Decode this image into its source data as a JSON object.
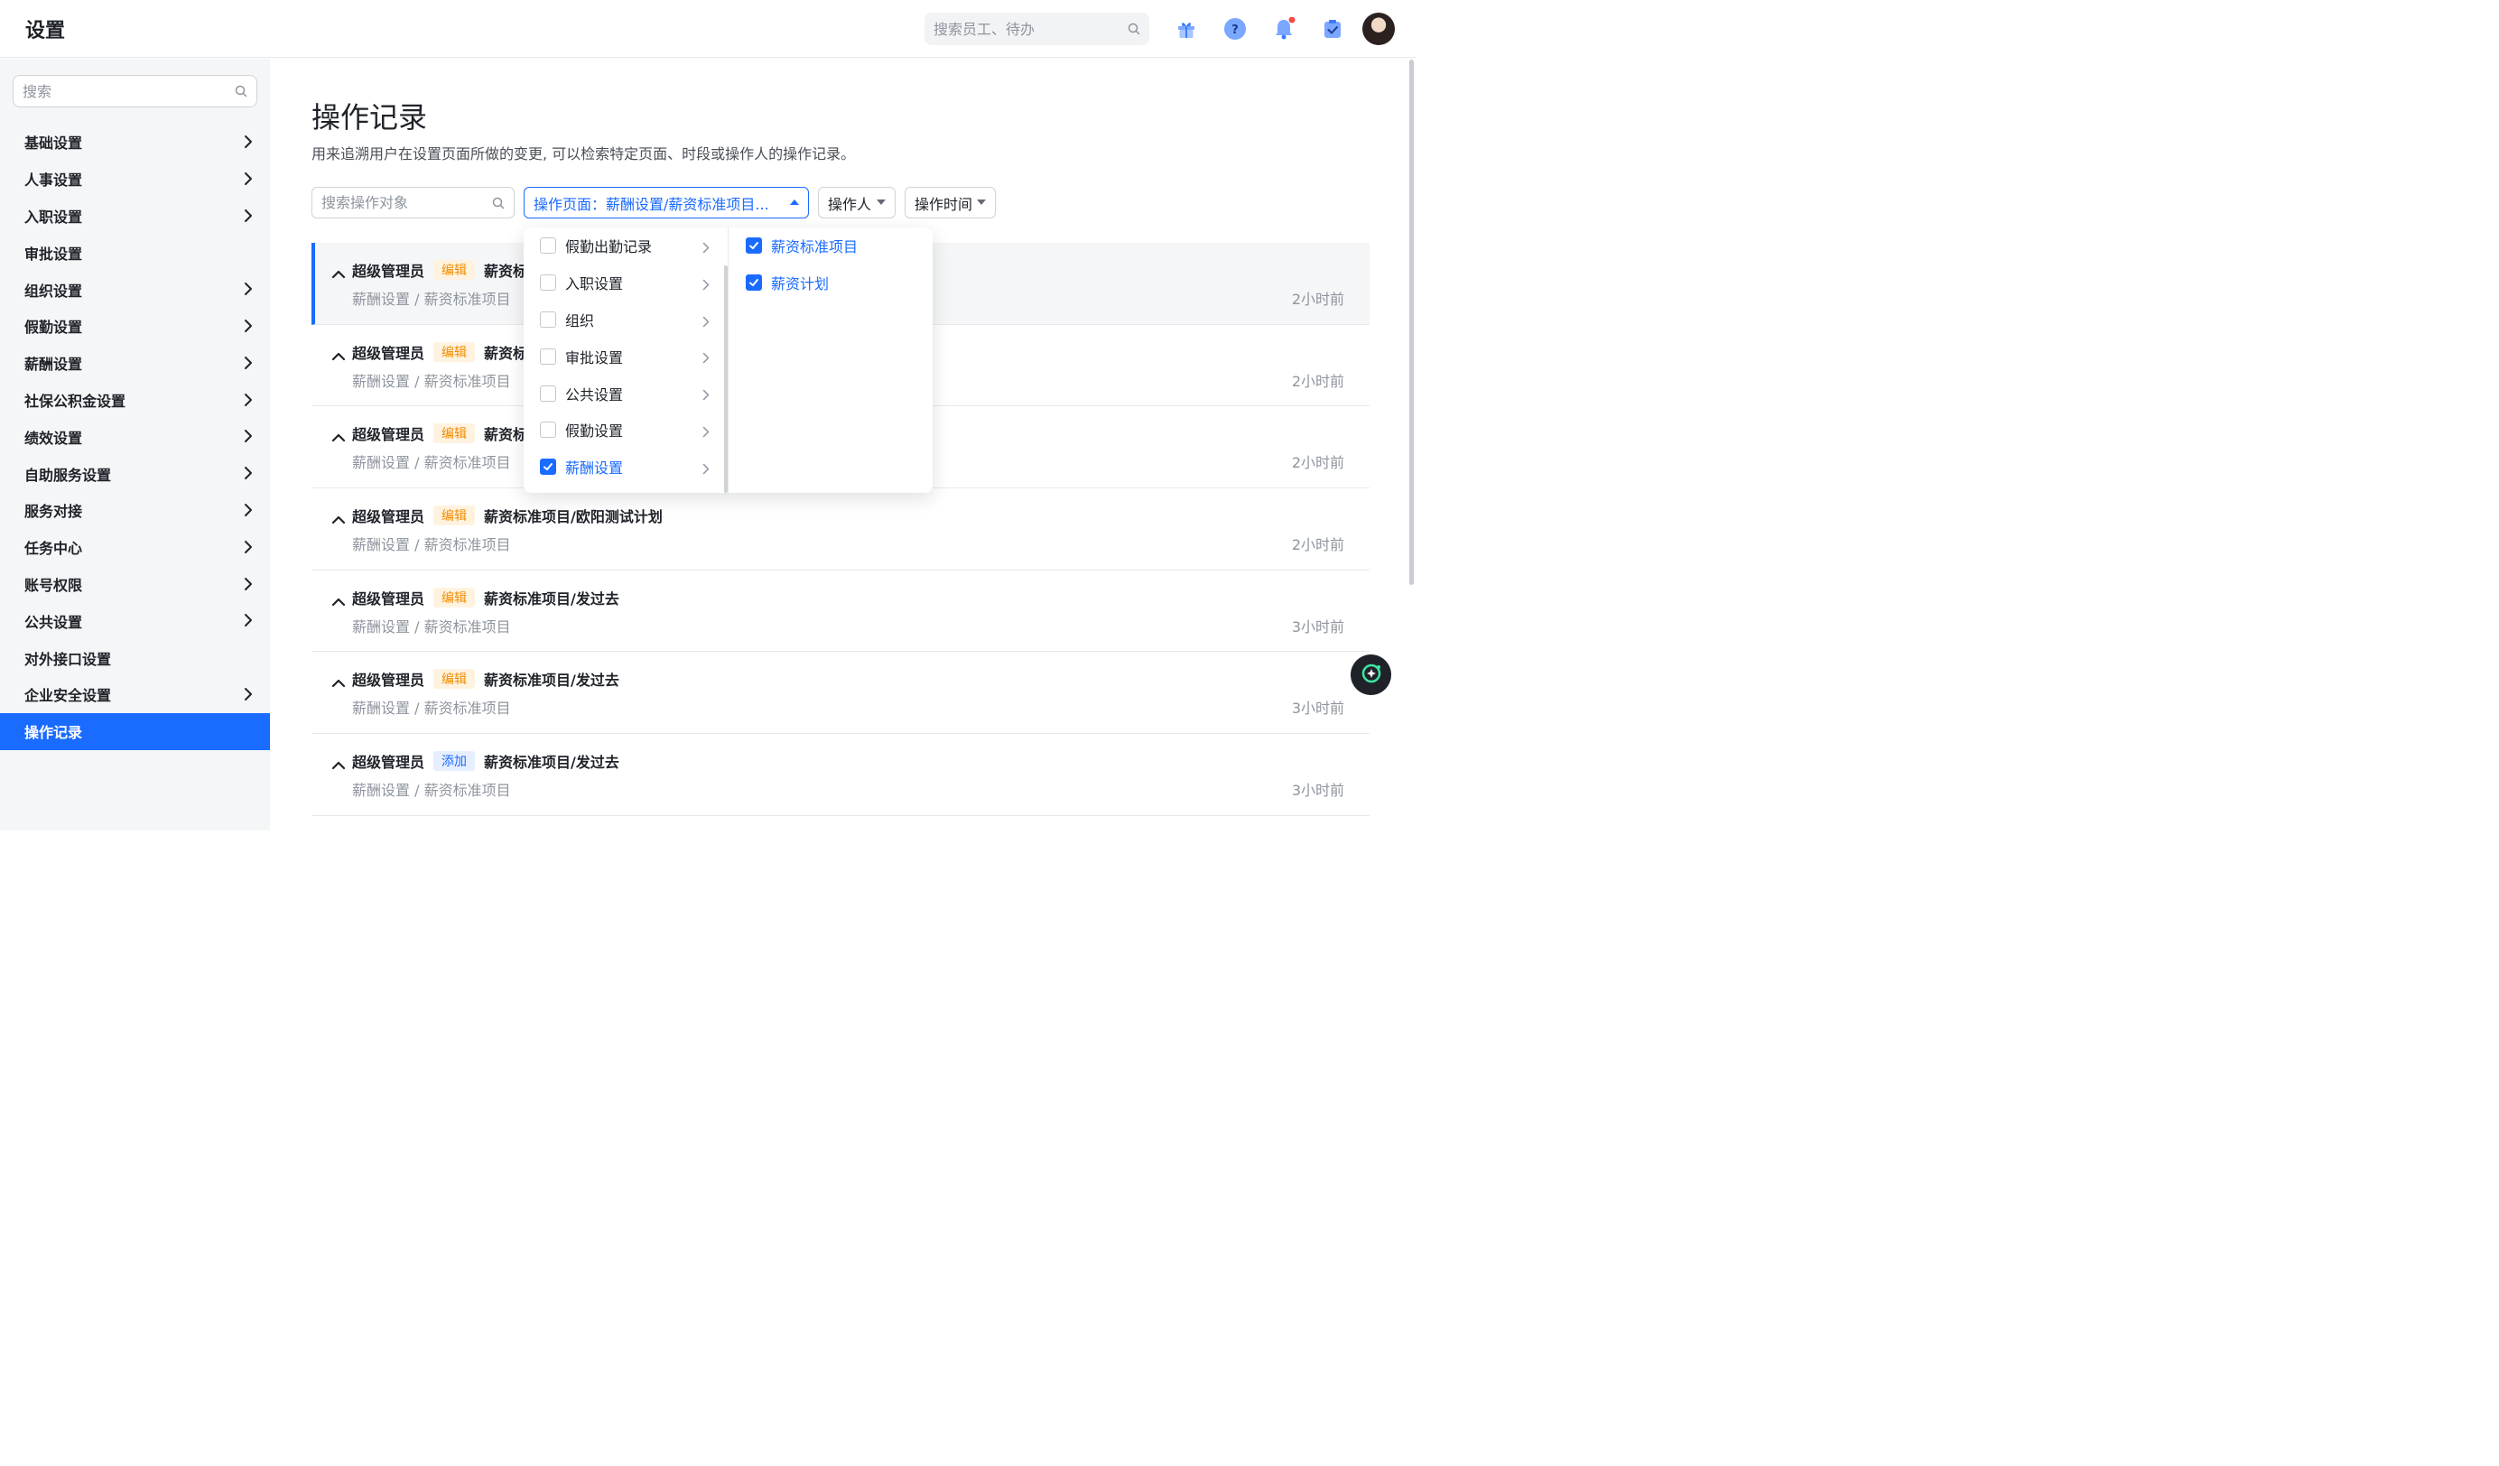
{
  "header": {
    "title": "设置",
    "search_placeholder": "搜索员工、待办"
  },
  "sidebar": {
    "search_placeholder": "搜索",
    "items": [
      {
        "label": "基础设置",
        "has_children": true
      },
      {
        "label": "人事设置",
        "has_children": true
      },
      {
        "label": "入职设置",
        "has_children": true
      },
      {
        "label": "审批设置",
        "has_children": false
      },
      {
        "label": "组织设置",
        "has_children": true
      },
      {
        "label": "假勤设置",
        "has_children": true
      },
      {
        "label": "薪酬设置",
        "has_children": true
      },
      {
        "label": "社保公积金设置",
        "has_children": true
      },
      {
        "label": "绩效设置",
        "has_children": true
      },
      {
        "label": "自助服务设置",
        "has_children": true
      },
      {
        "label": "服务对接",
        "has_children": true
      },
      {
        "label": "任务中心",
        "has_children": true
      },
      {
        "label": "账号权限",
        "has_children": true
      },
      {
        "label": "公共设置",
        "has_children": true
      },
      {
        "label": "对外接口设置",
        "has_children": false
      },
      {
        "label": "企业安全设置",
        "has_children": true
      },
      {
        "label": "操作记录",
        "has_children": false,
        "active": true
      }
    ]
  },
  "main": {
    "title": "操作记录",
    "description": "用来追溯用户在设置页面所做的变更, 可以检索特定页面、时段或操作人的操作记录。",
    "filters": {
      "search_placeholder": "搜索操作对象",
      "page_select": "操作页面：薪酬设置/薪资标准项目...",
      "operator_select": "操作人",
      "time_select": "操作时间"
    },
    "records": [
      {
        "user": "超级管理员",
        "action": "编辑",
        "object": "薪资标",
        "path": "薪酬设置 / 薪资标准项目",
        "time": "2小时前"
      },
      {
        "user": "超级管理员",
        "action": "编辑",
        "object": "薪资标",
        "path": "薪酬设置 / 薪资标准项目",
        "time": "2小时前"
      },
      {
        "user": "超级管理员",
        "action": "编辑",
        "object": "薪资标",
        "path": "薪酬设置 / 薪资标准项目",
        "time": "2小时前"
      },
      {
        "user": "超级管理员",
        "action": "编辑",
        "object": "薪资标准项目/欧阳测试计划",
        "path": "薪酬设置 / 薪资标准项目",
        "time": "2小时前"
      },
      {
        "user": "超级管理员",
        "action": "编辑",
        "object": "薪资标准项目/发过去",
        "path": "薪酬设置 / 薪资标准项目",
        "time": "3小时前"
      },
      {
        "user": "超级管理员",
        "action": "编辑",
        "object": "薪资标准项目/发过去",
        "path": "薪酬设置 / 薪资标准项目",
        "time": "3小时前"
      },
      {
        "user": "超级管理员",
        "action": "添加",
        "object": "薪资标准项目/发过去",
        "path": "薪酬设置 / 薪资标准项目",
        "time": "3小时前"
      }
    ]
  },
  "cascader": {
    "level1": [
      {
        "label": "假勤出勤记录",
        "checked": false
      },
      {
        "label": "入职设置",
        "checked": false
      },
      {
        "label": "组织",
        "checked": false
      },
      {
        "label": "审批设置",
        "checked": false
      },
      {
        "label": "公共设置",
        "checked": false
      },
      {
        "label": "假勤设置",
        "checked": false
      },
      {
        "label": "薪酬设置",
        "checked": true
      }
    ],
    "level2": [
      {
        "label": "薪资标准项目",
        "checked": true
      },
      {
        "label": "薪资计划",
        "checked": true
      }
    ]
  },
  "colors": {
    "accent": "#1a6bff",
    "edit_badge_text": "#f08c00",
    "edit_badge_bg": "#fff3e0",
    "add_badge_bg": "#e6efff",
    "notification_dot": "#f54a45"
  },
  "icons": {
    "header": [
      "gift-icon",
      "help-icon",
      "bell-icon",
      "task-check-icon"
    ],
    "fab": "ai-assistant-icon"
  }
}
